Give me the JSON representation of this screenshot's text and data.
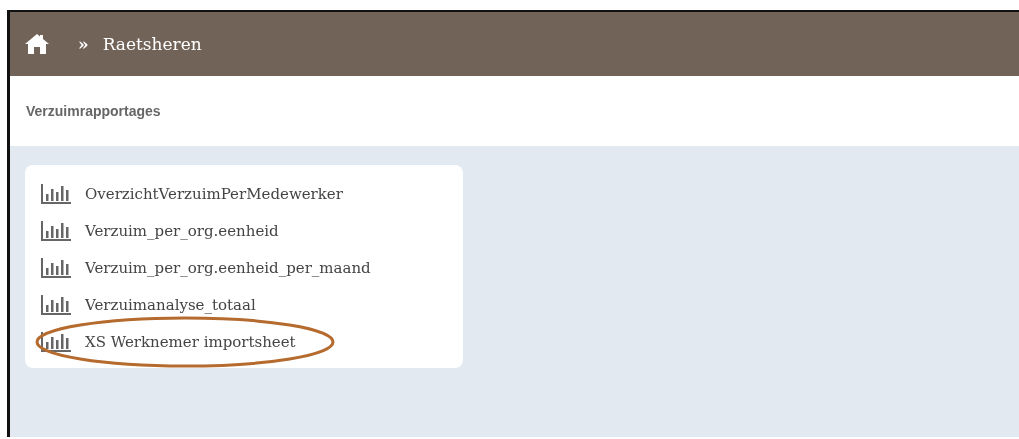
{
  "breadcrumb": {
    "separator": "»",
    "current": "Raetsheren"
  },
  "section_title": "Verzuimrapportages",
  "reports": [
    {
      "label": "OverzichtVerzuimPerMedewerker",
      "highlighted": false
    },
    {
      "label": "Verzuim_per_org.eenheid",
      "highlighted": false
    },
    {
      "label": "Verzuim_per_org.eenheid_per_maand",
      "highlighted": false
    },
    {
      "label": "Verzuimanalyse_totaal",
      "highlighted": false
    },
    {
      "label": "XS Werknemer importsheet",
      "highlighted": true
    }
  ]
}
